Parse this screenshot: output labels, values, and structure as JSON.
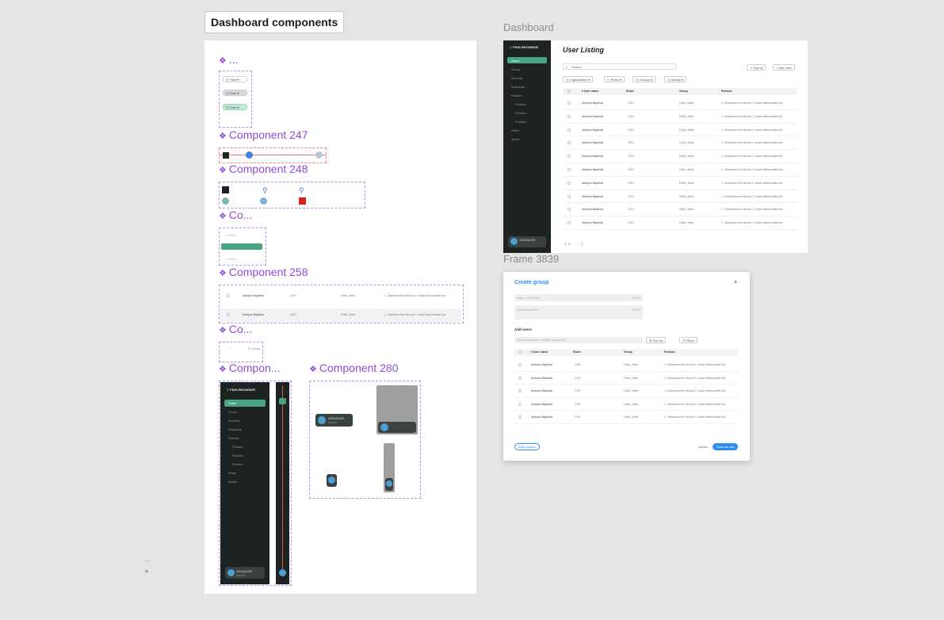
{
  "page_chip": "Dashboard components",
  "frame_labels": {
    "dashboard": "Dashboard",
    "frame": "Frame 3839"
  },
  "components": {
    "c1": "...",
    "c247": "Component 247",
    "c248": "Component 248",
    "co1": "Co...",
    "c258": "Component 258",
    "co2": "Co...",
    "compon": "Compon...",
    "c280": "Component 280"
  },
  "filter_pills": [
    "Time",
    "Time",
    "Time"
  ],
  "nav_variants": [
    "Roles",
    "Roles",
    "Roles"
  ],
  "group_chip": "Group",
  "comp258_rows": [
    {
      "name": "Ashlynn Baptista",
      "role": "CEO",
      "group": "Delhi_West",
      "policy": "1. Sdsdsrerrrsrrr fdsvsd 2. sdsdf sfdsrsrsdsfs fsd"
    },
    {
      "name": "Ashlynn Baptista",
      "role": "CEO",
      "group": "Delhi_West",
      "policy": "1. Sdsdsrerrrsrrr fdsvsd 2. sdsdf sfdsrsrsdsfs fsd"
    }
  ],
  "brand": "PING BROWSER",
  "sidebar_items": [
    "Roles",
    "Group",
    "Security",
    "Requests",
    "Policies",
    "Policies",
    "Policies",
    "Policies",
    "Rules",
    "Album"
  ],
  "user_chip": {
    "name": "333444020",
    "sub": "admin"
  },
  "dashboard": {
    "brand": "PING BROWSER",
    "nav": [
      "Users",
      "Group",
      "Security",
      "Requests",
      "Policies",
      "Policies",
      "Policies",
      "Policies",
      "Rules",
      "About"
    ],
    "title": "User Listing",
    "search_placeholder": "Search",
    "export": "Export",
    "add_user": "Add User",
    "filters": [
      "Organisation",
      "Roles",
      "Groups",
      "Activity"
    ],
    "columns": [
      "User name",
      "Roles",
      "Group",
      "Policies"
    ],
    "rows": [
      {
        "name": "Ashlynn Baptista",
        "role": "CEO",
        "group": "Delhi_West",
        "policy": "1. Sdsdsrerrrsrrr fdsvsd 2. sdsdf sfdsrsrsdsfs fsd"
      },
      {
        "name": "Ashlynn Baptista",
        "role": "CEO",
        "group": "Delhi_West",
        "policy": "1. Sdsdsrerrrsrrr fdsvsd 2. sdsdf sfdsrsrsdsfs fsd"
      },
      {
        "name": "Ashlynn Baptista",
        "role": "CEO",
        "group": "Delhi_West",
        "policy": "1. Sdsdsrerrrsrrr fdsvsd 2. sdsdf sfdsrsrsdsfs fsd"
      },
      {
        "name": "Ashlynn Baptista",
        "role": "CEO",
        "group": "Delhi_West",
        "policy": "1. Sdsdsrerrrsrrr fdsvsd 2. sdsdf sfdsrsrsdsfs fsd"
      },
      {
        "name": "Ashlynn Baptista",
        "role": "CEO",
        "group": "Delhi_West",
        "policy": "1. Sdsdsrerrrsrrr fdsvsd 2. sdsdf sfdsrsrsdsfs fsd"
      },
      {
        "name": "Ashlynn Baptista",
        "role": "CEO",
        "group": "Delhi_West",
        "policy": "1. Sdsdsrerrrsrrr fdsvsd 2. sdsdf sfdsrsrsdsfs fsd"
      },
      {
        "name": "Ashlynn Baptista",
        "role": "CEO",
        "group": "Delhi_West",
        "policy": "1. Sdsdsrerrrsrrr fdsvsd 2. sdsdf sfdsrsrsdsfs fsd"
      },
      {
        "name": "Ashlynn Baptista",
        "role": "CEO",
        "group": "Delhi_West",
        "policy": "1. Sdsdsrerrrsrrr fdsvsd 2. sdsdf sfdsrsrsdsfs fsd"
      },
      {
        "name": "Ashlynn Baptista",
        "role": "CEO",
        "group": "Delhi_West",
        "policy": "1. Sdsdsrerrrsrrr fdsvsd 2. sdsdf sfdsrsrsdsfs fsd"
      },
      {
        "name": "Ashlynn Baptista",
        "role": "CEO",
        "group": "Delhi_West",
        "policy": "1. Sdsdsrerrrsrrr fdsvsd 2. sdsdf sfdsrsrsdsfs fsd"
      }
    ]
  },
  "modal": {
    "title": "Create group",
    "name_placeholder": "Name of the role",
    "name_count": "0/100",
    "desc_placeholder": "Add description",
    "desc_count": "0/300",
    "add_users": "Add users",
    "search_placeholder": "Search by name / email, group etc",
    "sort": "Sort by",
    "filters": "Filters",
    "columns": [
      "User name",
      "Roles",
      "Group",
      "Policies"
    ],
    "rows": [
      {
        "name": "Ashlynn Baptista",
        "role": "CEO",
        "group": "Delhi_West",
        "policy": "1. Sdsdsrerrrsrrr fdsvsd 2. sdsdf sfdsrsrsdsfs fsd"
      },
      {
        "name": "Ashlynn Baptista",
        "role": "CEO",
        "group": "Delhi_West",
        "policy": "1. Sdsdsrerrrsrrr fdsvsd 2. sdsdf sfdsrsrsdsfs fsd"
      },
      {
        "name": "Ashlynn Baptista",
        "role": "CEO",
        "group": "Delhi_West",
        "policy": "1. Sdsdsrerrrsrrr fdsvsd 2. sdsdf sfdsrsrsdsfs fsd"
      },
      {
        "name": "Ashlynn Baptista",
        "role": "CEO",
        "group": "Delhi_West",
        "policy": "1. Sdsdsrerrrsrrr fdsvsd 2. sdsdf sfdsrsrsdsfs fsd"
      },
      {
        "name": "Ashlynn Baptista",
        "role": "CEO",
        "group": "Delhi_West",
        "policy": "1. Sdsdsrerrrsrrr fdsvsd 2. sdsdf sfdsrsrsdsfs fsd"
      }
    ],
    "add_policies": "Add policies",
    "cancel": "cancel",
    "save": "Save as role"
  },
  "colors": {
    "accent_purple": "#8f4cd7",
    "brand_green": "#48a381",
    "sidebar_dark": "#1c2321",
    "primary_blue": "#2c8df0"
  }
}
